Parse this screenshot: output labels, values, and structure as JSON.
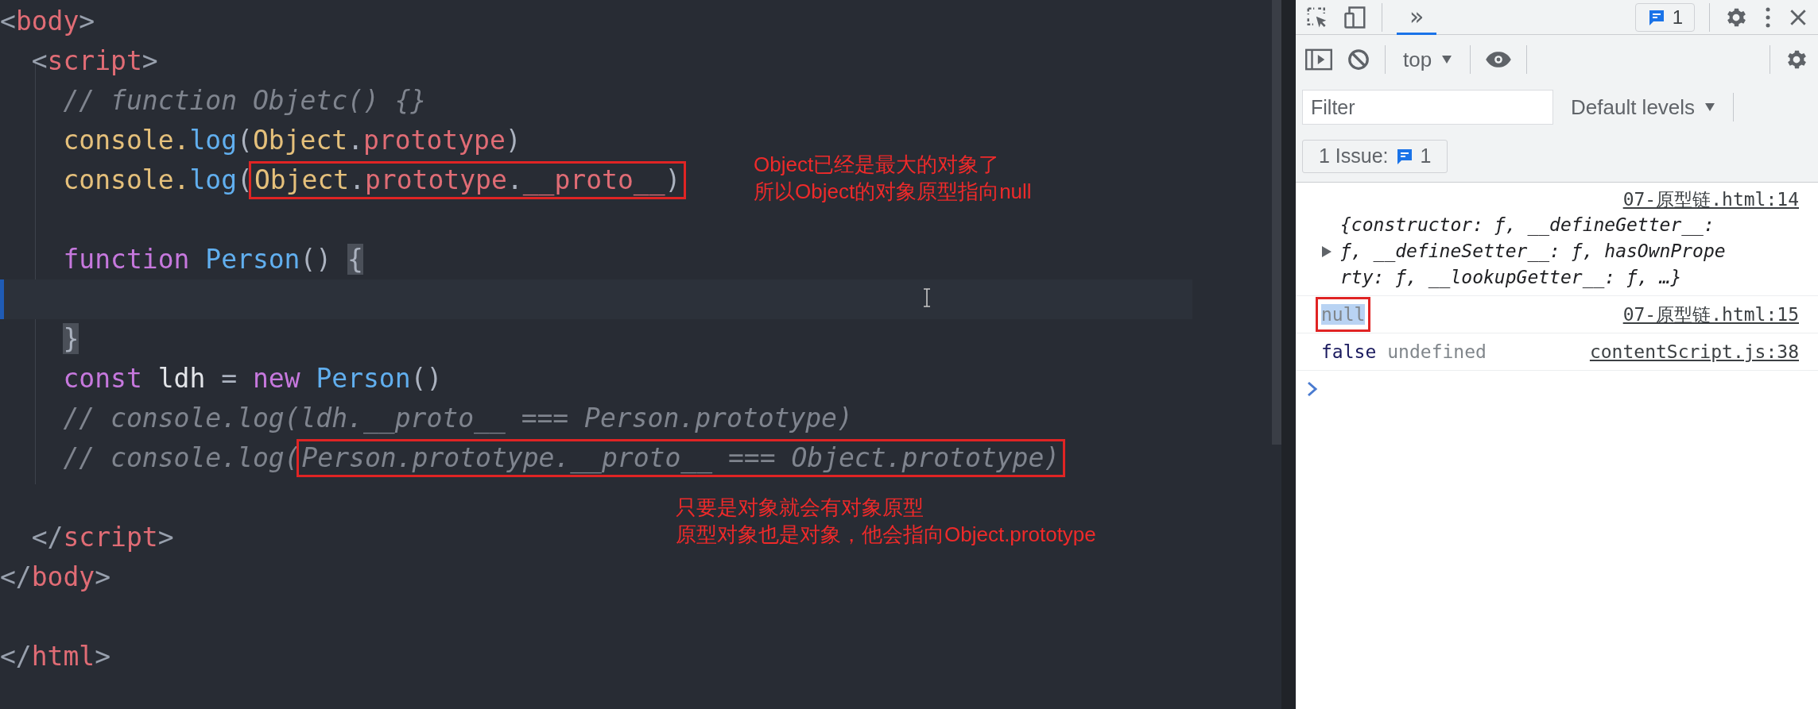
{
  "editor": {
    "lines": [
      {
        "current": false,
        "segments": [
          {
            "boxed": false,
            "tokens": [
              {
                "text": "<",
                "kind": "punct"
              },
              {
                "text": "body",
                "kind": "tag"
              },
              {
                "text": ">",
                "kind": "punct"
              }
            ]
          }
        ]
      },
      {
        "current": false,
        "segments": [
          {
            "boxed": false,
            "tokens": [
              {
                "text": "  <",
                "kind": "punct"
              },
              {
                "text": "script",
                "kind": "tag"
              },
              {
                "text": ">",
                "kind": "punct"
              }
            ]
          }
        ]
      },
      {
        "current": false,
        "segments": [
          {
            "boxed": false,
            "tokens": [
              {
                "text": "    // function Objetc() {}",
                "kind": "comment"
              }
            ]
          }
        ]
      },
      {
        "current": false,
        "segments": [
          {
            "boxed": false,
            "tokens": [
              {
                "text": "    console.",
                "kind": "ident"
              },
              {
                "text": "log",
                "kind": "method"
              },
              {
                "text": "(",
                "kind": "plain"
              },
              {
                "text": "Object",
                "kind": "ident"
              },
              {
                "text": ".",
                "kind": "plain"
              },
              {
                "text": "prototype",
                "kind": "prop"
              },
              {
                "text": ")",
                "kind": "plain"
              }
            ]
          }
        ]
      },
      {
        "current": false,
        "segments": [
          {
            "boxed": false,
            "tokens": [
              {
                "text": "    console.",
                "kind": "ident"
              },
              {
                "text": "log",
                "kind": "method"
              },
              {
                "text": "(",
                "kind": "plain"
              }
            ]
          },
          {
            "boxed": true,
            "tokens": [
              {
                "text": "Object",
                "kind": "ident"
              },
              {
                "text": ".",
                "kind": "plain"
              },
              {
                "text": "prototype",
                "kind": "prop"
              },
              {
                "text": ".",
                "kind": "plain"
              },
              {
                "text": "__proto__",
                "kind": "prop"
              },
              {
                "text": ")",
                "kind": "plain"
              }
            ]
          }
        ]
      },
      {
        "current": false
      },
      {
        "current": false,
        "segments": [
          {
            "boxed": false,
            "tokens": [
              {
                "text": "    function ",
                "kind": "keyword"
              },
              {
                "text": "Person",
                "kind": "func"
              },
              {
                "text": "() ",
                "kind": "plain"
              },
              {
                "text": "{",
                "kind": "bracket-match"
              }
            ]
          }
        ]
      },
      {
        "current": true
      },
      {
        "current": false,
        "segments": [
          {
            "boxed": false,
            "tokens": [
              {
                "text": "    }",
                "kind": "bracket-match"
              }
            ]
          }
        ]
      },
      {
        "current": false,
        "segments": [
          {
            "boxed": false,
            "tokens": [
              {
                "text": "    const",
                "kind": "keyword"
              },
              {
                "text": " ldh",
                "kind": "var"
              },
              {
                "text": " = ",
                "kind": "plain"
              },
              {
                "text": "new ",
                "kind": "keyword"
              },
              {
                "text": "Person",
                "kind": "func"
              },
              {
                "text": "()",
                "kind": "plain"
              }
            ]
          }
        ]
      },
      {
        "current": false,
        "segments": [
          {
            "boxed": false,
            "tokens": [
              {
                "text": "    // console.log(ldh.__proto__ === Person.prototype)",
                "kind": "comment"
              }
            ]
          }
        ]
      },
      {
        "current": false,
        "segments": [
          {
            "boxed": false,
            "tokens": [
              {
                "text": "    // console.log(",
                "kind": "comment"
              }
            ]
          },
          {
            "boxed": true,
            "tokens": [
              {
                "text": "Person.prototype.__proto__ === Object.prototype)",
                "kind": "comment"
              }
            ]
          }
        ]
      },
      {
        "current": false
      },
      {
        "current": false,
        "segments": [
          {
            "boxed": false,
            "tokens": [
              {
                "text": "  </",
                "kind": "punct"
              },
              {
                "text": "script",
                "kind": "tag"
              },
              {
                "text": ">",
                "kind": "punct"
              }
            ]
          }
        ]
      },
      {
        "current": false,
        "segments": [
          {
            "boxed": false,
            "tokens": [
              {
                "text": "</",
                "kind": "punct"
              },
              {
                "text": "body",
                "kind": "tag"
              },
              {
                "text": ">",
                "kind": "punct"
              }
            ]
          }
        ]
      },
      {
        "current": false
      },
      {
        "current": false,
        "segments": [
          {
            "boxed": false,
            "tokens": [
              {
                "text": "</",
                "kind": "punct"
              },
              {
                "text": "html",
                "kind": "tag"
              },
              {
                "text": ">",
                "kind": "punct"
              }
            ]
          }
        ]
      }
    ],
    "annotations": [
      {
        "lines": [
          "Object已经是最大的对象了",
          "所以Object的对象原型指向null"
        ]
      },
      {
        "lines": [
          "只要是对象就会有对象原型",
          "原型对象也是对象，他会指向Object.prototype"
        ]
      }
    ]
  },
  "devtools": {
    "tabs": [
      {
        "label": "»",
        "selected": true
      }
    ],
    "issues_badge": "1",
    "context": "top",
    "filter": {
      "placeholder": "Filter"
    },
    "levels": "Default levels",
    "issues_button": {
      "label": "1 Issue:",
      "count": "1"
    },
    "messages": [
      {
        "kind": "object",
        "expanded": false,
        "source": "07-原型链.html:14",
        "values": [
          {
            "text": "{constructor: ƒ, __defineGetter__: ƒ, __defineSetter__: ƒ, hasOwnProperty: ƒ, __lookupGetter__: ƒ, …}",
            "kind": "object"
          }
        ]
      },
      {
        "kind": "value",
        "source": "07-原型链.html:15",
        "values": [
          {
            "text": "null",
            "kind": "null",
            "selected": true,
            "boxed": true
          }
        ]
      },
      {
        "kind": "value",
        "source": "contentScript.js:38",
        "values": [
          {
            "text": "false",
            "kind": "boolean",
            "selected": false,
            "boxed": false
          },
          {
            "text": "undefined",
            "kind": "undefined",
            "selected": false,
            "boxed": false
          }
        ]
      }
    ]
  }
}
